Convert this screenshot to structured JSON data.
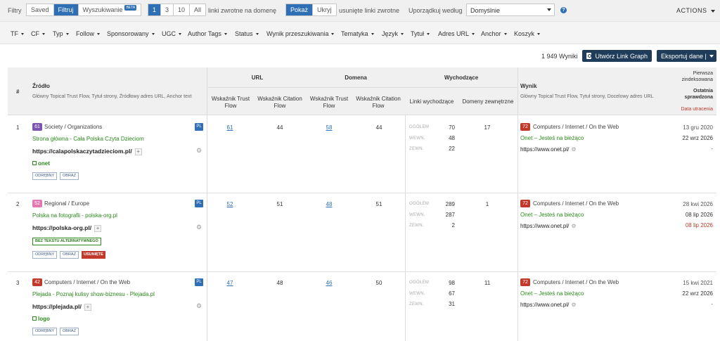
{
  "toolbar": {
    "filtry": "Filtry",
    "saved": "Saved",
    "filtruj": "Filtruj",
    "wyszukiwanie": "Wyszukiwanie",
    "beta": "BETA",
    "per_domain": [
      "1",
      "3",
      "10",
      "All"
    ],
    "per_domain_label": "linki zwrotne na domenę",
    "show": "Pokaż",
    "hide": "Ukryj",
    "deleted_label": "usunięte linki zwrotne",
    "sort_label": "Uporządkuj według",
    "sort_value": "Domyślnie",
    "help": "?",
    "actions": "ACTIONS"
  },
  "filters": [
    "TF",
    "CF",
    "Typ",
    "Follow",
    "Sponsorowany",
    "UGC",
    "Author Tags",
    "Status",
    "Wynik przeszukiwania",
    "Tematyka",
    "Język",
    "Tytuł",
    "Adres URL",
    "Anchor",
    "Koszyk"
  ],
  "results": {
    "count": "1 949 Wyniki",
    "link_graph": "Utwórz Link Graph",
    "export": "Eksportuj dane |"
  },
  "table": {
    "h_num": "#",
    "h_source": "Źródło",
    "h_source_sub": "Główny Topical Trust Flow, Tytuł strony, Źródłowy adres URL, Anchor text",
    "h_url": "URL",
    "h_domain": "Domena",
    "h_out": "Wychodzące",
    "h_tf": "Wskaźnik Trust Flow",
    "h_cf": "Wskaźnik Citation Flow",
    "h_out_links": "Linki wychodzące",
    "h_ext_domains": "Domeny zewnętrzne",
    "h_result": "Wynik",
    "h_result_sub": "Główny Topical Trust Flow, Tytuł strony, Docelowy adres URL",
    "h_first": "Pierwsza zindeksowana",
    "h_last": "Ostatnia sprawdzona",
    "h_lost": "Data utracenia",
    "lbl_total": "OGÓŁEM",
    "lbl_int": "WEWN.",
    "lbl_ext": "ZEWN."
  },
  "rows": [
    {
      "num": "1",
      "ttf": "61",
      "ttf_color": "#7b55b0",
      "category": "Society / Organizations",
      "title": "Strona główna - Cała Polska Czyta Dzieciom",
      "url": "https://calapolskaczytadzieciom.pl/",
      "anchor": "onet",
      "tags": [
        "ODRĘBNY",
        "OBRAZ"
      ],
      "lang": "PL",
      "url_tf": "61",
      "url_cf": "44",
      "dom_tf": "58",
      "dom_cf": "44",
      "out_total": "70",
      "out_int": "48",
      "out_ext": "22",
      "ext_domains": "17",
      "res_ttf": "72",
      "res_category": "Computers / Internet / On the Web",
      "res_title": "Onet – Jesteś na bieżąco",
      "res_url": "https://www.onet.pl/",
      "first": "13 gru 2020",
      "last": "22 wrz 2026",
      "lost": "-"
    },
    {
      "num": "2",
      "ttf": "52",
      "ttf_color": "#e377b2",
      "category": "Regional / Europe",
      "title": "Polska na fotografii - polska-org.pl",
      "url": "https://polska-org.pl/",
      "badge_green": "BEZ TEKSTU ALTERNATYWNEGO",
      "tags": [
        "ODRĘBNY",
        "OBRAZ"
      ],
      "badge_red": "USUNIĘTE",
      "lang": "PL",
      "url_tf": "52",
      "url_cf": "51",
      "dom_tf": "48",
      "dom_cf": "51",
      "out_total": "289",
      "out_int": "287",
      "out_ext": "2",
      "ext_domains": "1",
      "res_ttf": "72",
      "res_category": "Computers / Internet / On the Web",
      "res_title": "Onet – Jesteś na bieżąco",
      "res_url": "https://www.onet.pl/",
      "first": "28 kwi 2026",
      "last": "08 lip 2026",
      "lost": "08 lip 2026"
    },
    {
      "num": "3",
      "ttf": "42",
      "ttf_color": "#c0392b",
      "category": "Computers / Internet / On the Web",
      "title": "Plejada - Poznaj kulisy show-biznesu - Plejada.pl",
      "url": "https://plejada.pl/",
      "anchor": "logo",
      "tags": [
        "ODRĘBNY",
        "OBRAZ"
      ],
      "lang": "PL",
      "url_tf": "47",
      "url_cf": "48",
      "dom_tf": "46",
      "dom_cf": "50",
      "out_total": "98",
      "out_int": "67",
      "out_ext": "31",
      "ext_domains": "11",
      "res_ttf": "72",
      "res_category": "Computers / Internet / On the Web",
      "res_title": "Onet – Jesteś na bieżąco",
      "res_url": "https://www.onet.pl/",
      "first": "15 kwi 2021",
      "last": "22 wrz 2026",
      "lost": "-"
    }
  ],
  "colors": {
    "accent": "#2f6fb5",
    "dark_button": "#1f3d5a",
    "green": "#2a8a1a",
    "red": "#c0392b"
  }
}
